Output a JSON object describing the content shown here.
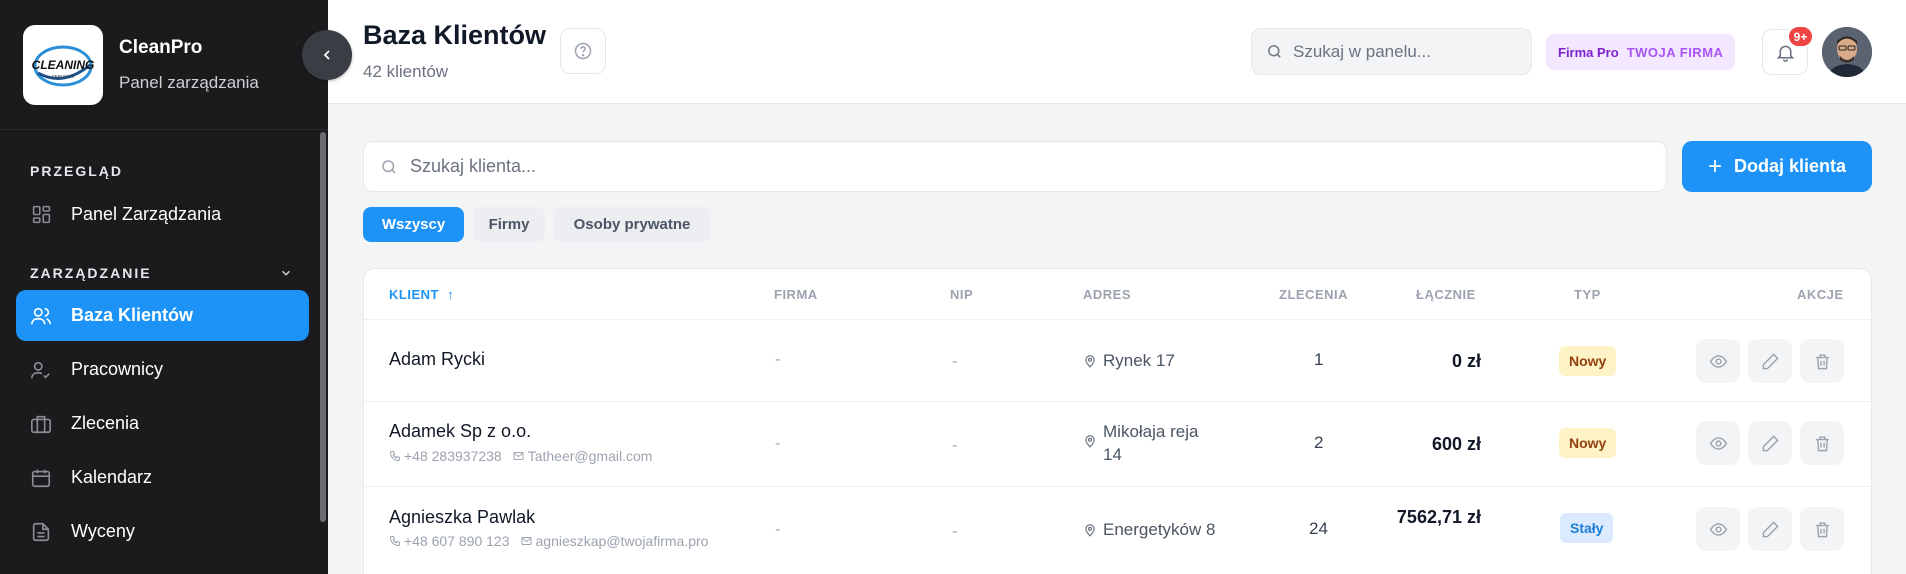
{
  "brand": {
    "name": "CleanPro",
    "subtitle": "Panel zarządzania",
    "logo_text": "CLEANING",
    "logo_sub": "SERVICES"
  },
  "sidebar": {
    "section_overview": "PRZEGLĄD",
    "section_manage": "ZARZĄDZANIE",
    "items": [
      {
        "label": "Panel Zarządzania",
        "icon": "dashboard-icon"
      },
      {
        "label": "Baza Klientów",
        "icon": "users-icon",
        "active": true
      },
      {
        "label": "Pracownicy",
        "icon": "user-check-icon"
      },
      {
        "label": "Zlecenia",
        "icon": "briefcase-icon"
      },
      {
        "label": "Kalendarz",
        "icon": "calendar-icon"
      },
      {
        "label": "Wyceny",
        "icon": "document-icon"
      }
    ]
  },
  "header": {
    "title": "Baza Klientów",
    "subtitle": "42 klientów",
    "search_placeholder": "Szukaj w panelu...",
    "plan_label": "Firma Pro",
    "company_label": "TWOJA FIRMA",
    "notifications": "9+"
  },
  "main": {
    "search_placeholder": "Szukaj klienta...",
    "add_button": "Dodaj klienta",
    "add_icon": "+",
    "filters": [
      "Wszyscy",
      "Firmy",
      "Osoby prywatne"
    ],
    "active_filter": "Wszyscy"
  },
  "table": {
    "columns": {
      "client": "KLIENT",
      "company": "FIRMA",
      "nip": "NIP",
      "address": "ADRES",
      "orders": "ZLECENIA",
      "total": "ŁĄCZNIE",
      "type": "TYP",
      "actions": "AKCJE"
    },
    "sort_indicator": "↑",
    "rows": [
      {
        "name": "Adam Rycki",
        "phone": "",
        "email": "",
        "company": "-",
        "nip": "-",
        "address": "Rynek 17",
        "orders": "1",
        "total": "0 zł",
        "type": "Nowy"
      },
      {
        "name": "Adamek Sp z o.o.",
        "phone": "+48 283937238",
        "email": "Tatheer@gmail.com",
        "company": "-",
        "nip": "-",
        "address": "Mikołaja reja 14",
        "orders": "2",
        "total": "600 zł",
        "type": "Nowy"
      },
      {
        "name": "Agnieszka Pawlak",
        "phone": "+48 607 890 123",
        "email": "agnieszkap@twojafirma.pro",
        "company": "-",
        "nip": "-",
        "address": "Energetyków 8",
        "orders": "24",
        "total": "7562,71 zł",
        "type": "Stały"
      }
    ]
  },
  "colors": {
    "accent": "#1e93f7",
    "sidebar_bg": "#1b1b1d",
    "badge_new_bg": "#fef3c7",
    "badge_regular_bg": "#dbeafe",
    "notification": "#ef4444"
  }
}
